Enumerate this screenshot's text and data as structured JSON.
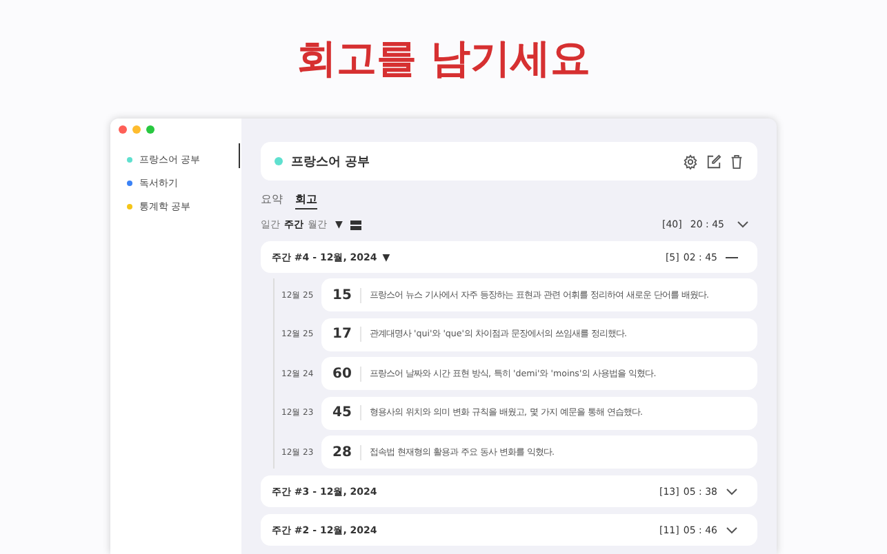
{
  "headline": "회고를 남기세요",
  "sidebar": {
    "items": [
      {
        "label": "프랑스어 공부",
        "color": "#5fe0cf"
      },
      {
        "label": "독서하기",
        "color": "#3b82f6"
      },
      {
        "label": "통계학 공부",
        "color": "#f5c518"
      }
    ]
  },
  "header": {
    "title": "프랑스어 공부",
    "color": "#5fe0cf"
  },
  "tabs": [
    {
      "label": "요약",
      "selected": false
    },
    {
      "label": "회고",
      "selected": true
    }
  ],
  "filters": [
    {
      "label": "일간",
      "selected": false
    },
    {
      "label": "주간",
      "selected": true
    },
    {
      "label": "월간",
      "selected": false
    }
  ],
  "filter_caret": "▼",
  "total": {
    "count": "[40]",
    "time": "20 : 45"
  },
  "weeks": [
    {
      "title": "주간 #4 - 12월, 2024",
      "caret": "▼",
      "count": "[5]",
      "time": "02 : 45",
      "expanded": true,
      "entries": [
        {
          "date": "12월 25",
          "minutes": "15",
          "text": "프랑스어 뉴스 기사에서 자주 등장하는 표현과 관련 어휘를 정리하여 새로운 단어를 배웠다."
        },
        {
          "date": "12월 25",
          "minutes": "17",
          "text": "관계대명사 'qui'와 'que'의 차이점과 문장에서의 쓰임새를 정리했다."
        },
        {
          "date": "12월 24",
          "minutes": "60",
          "text": "프랑스어 날짜와 시간 표현 방식, 특히 'demi'와 'moins'의 사용법을 익혔다."
        },
        {
          "date": "12월 23",
          "minutes": "45",
          "text": "형용사의 위치와 의미 변화 규칙을 배웠고, 몇 가지 예문을 통해 연습했다."
        },
        {
          "date": "12월 23",
          "minutes": "28",
          "text": "접속법 현재형의 활용과 주요 동사 변화를 익혔다."
        }
      ]
    },
    {
      "title": "주간 #3 - 12월, 2024",
      "count": "[13]",
      "time": "05 : 38",
      "expanded": false
    },
    {
      "title": "주간 #2 - 12월, 2024",
      "count": "[11]",
      "time": "05 : 46",
      "expanded": false
    }
  ]
}
